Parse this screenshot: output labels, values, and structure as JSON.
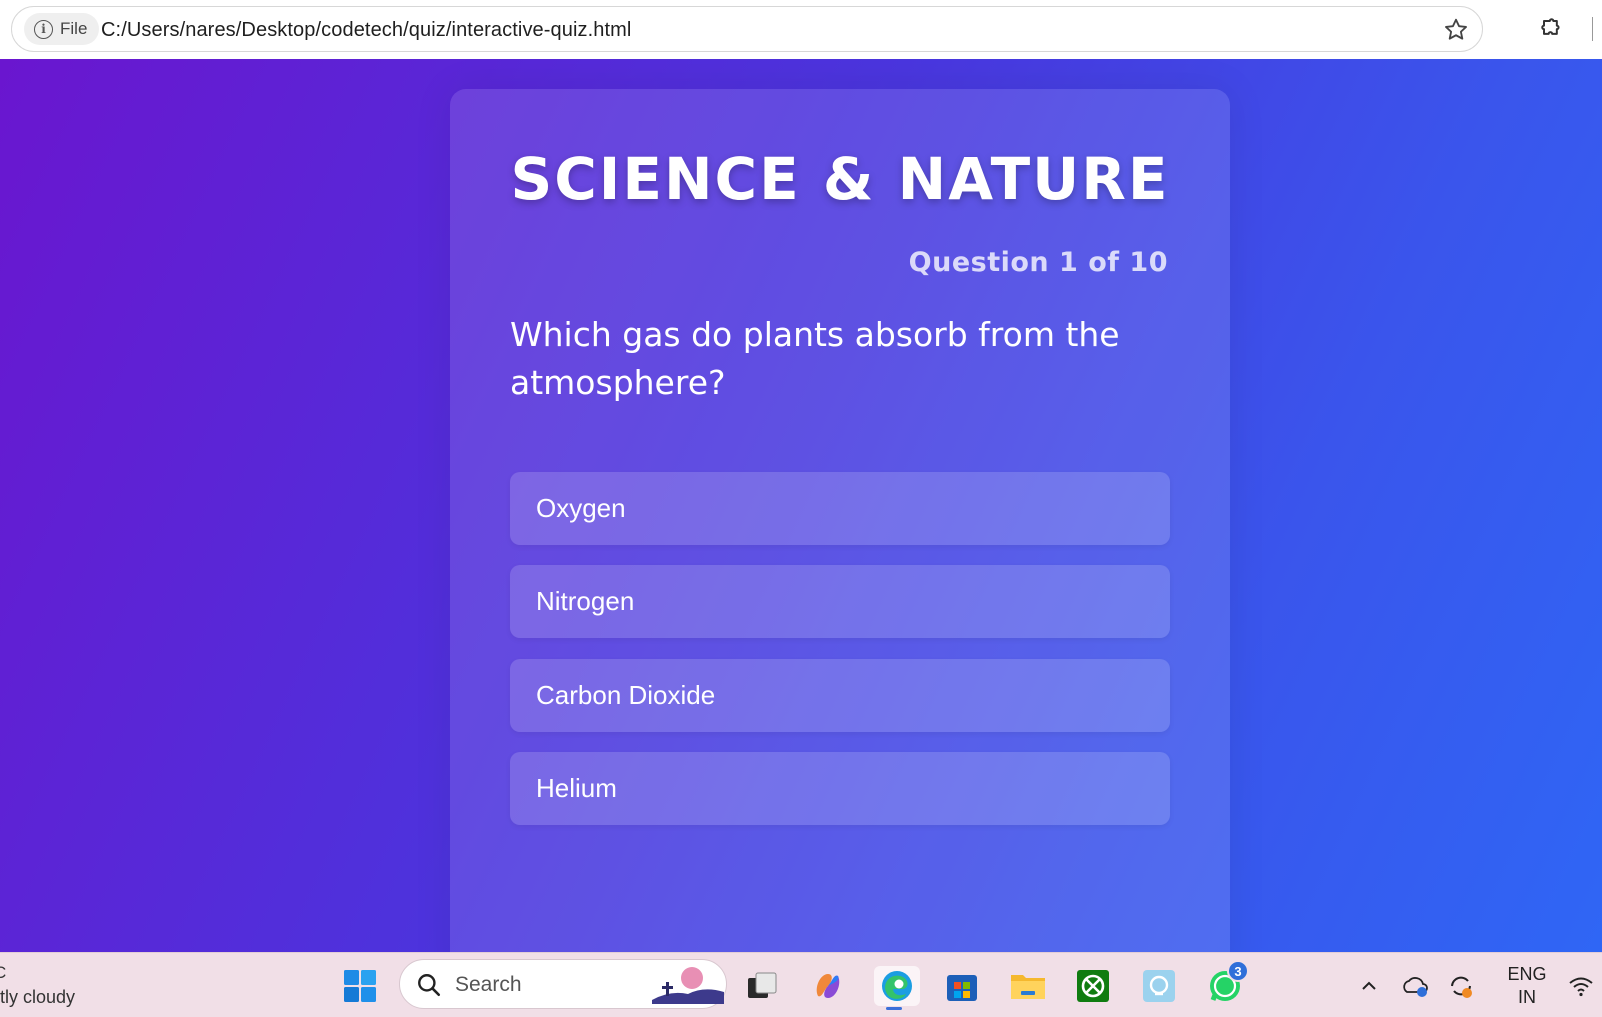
{
  "browser": {
    "file_label": "File",
    "url": "C:/Users/nares/Desktop/codetech/quiz/interactive-quiz.html"
  },
  "quiz": {
    "title": "SCIENCE & NATURE",
    "counter": "Question 1 of 10",
    "question": "Which gas do plants absorb from the atmosphere?",
    "options": [
      "Oxygen",
      "Nitrogen",
      "Carbon Dioxide",
      "Helium"
    ]
  },
  "taskbar": {
    "weather_temp": "C",
    "weather_desc": "tly cloudy",
    "search_placeholder": "Search",
    "whatsapp_badge": "3",
    "language_line1": "ENG",
    "language_line2": "IN"
  },
  "colors": {
    "gradient_start": "#6a16cf",
    "gradient_end": "#2f66f5",
    "accent": "#3b6fd9"
  }
}
